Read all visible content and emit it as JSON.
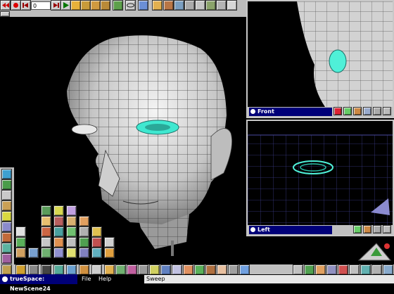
{
  "toolbar": {
    "frame_value": "0"
  },
  "main_view": {
    "name": "main-viewport"
  },
  "viewports": {
    "front": {
      "title": "Front"
    },
    "left": {
      "title": "Left"
    }
  },
  "statusbar": {
    "scene_title": "trueSpace: NewScene24",
    "menu_file": "File",
    "menu_help": "Help",
    "message": "Sweep"
  },
  "colors": {
    "title_bar": "#000078",
    "panel_bg": "#c0c0c0",
    "eye_highlight": "#4ff0d8",
    "wireframe": "#5a5aa8"
  },
  "icons": [
    "record-icon",
    "rewind-icon",
    "play-icon",
    "keyframe-icon",
    "move-icon",
    "rotate-icon",
    "scale-icon",
    "render-icon",
    "camera-icon",
    "light-icon",
    "material-icon",
    "sphere-icon",
    "cube-icon",
    "cylinder-icon",
    "undo-icon",
    "delete-icon"
  ]
}
